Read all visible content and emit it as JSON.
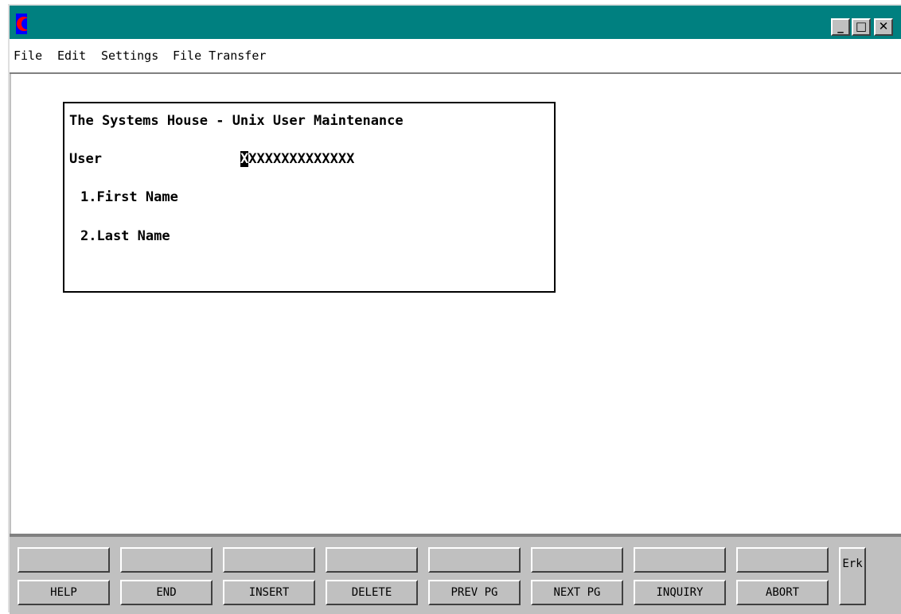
{
  "window": {
    "icon": "crescent-app-icon",
    "controls": {
      "minimize": "_",
      "maximize": "□",
      "close": "✕"
    },
    "accent_color": "#008080"
  },
  "menu": {
    "items": [
      "File",
      "Edit",
      "Settings",
      "File Transfer"
    ]
  },
  "screen": {
    "title": "The Systems House - Unix User Maintenance",
    "user_label": "User",
    "user_value_cursor": "X",
    "user_value_rest": "XXXXXXXXXXXXX",
    "fields": [
      {
        "label": "1.First Name",
        "value": ""
      },
      {
        "label": "2.Last Name",
        "value": ""
      }
    ]
  },
  "function_keys": {
    "top_row": [
      "",
      "",
      "",
      "",
      "",
      "",
      "",
      ""
    ],
    "bottom_row": [
      "HELP",
      "END",
      "INSERT",
      "DELETE",
      "PREV PG",
      "NEXT PG",
      "INQUIRY",
      "ABORT"
    ],
    "extra_key": "Erk"
  }
}
